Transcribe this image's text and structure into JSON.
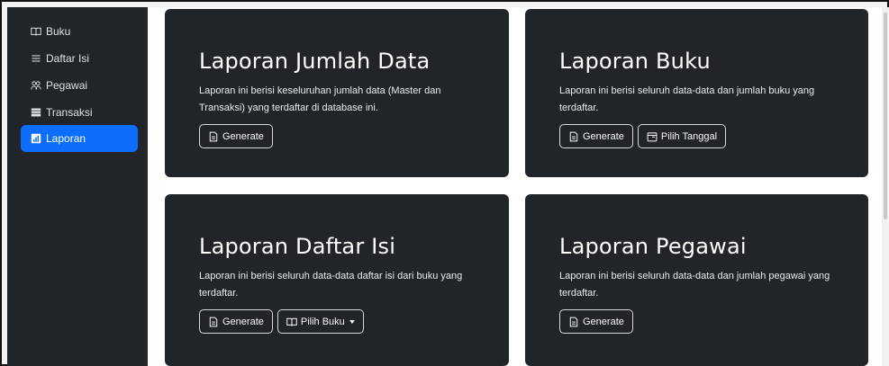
{
  "sidebar": {
    "items": [
      {
        "label": "Buku",
        "icon": "book-icon",
        "active": false
      },
      {
        "label": "Daftar Isi",
        "icon": "list-icon",
        "active": false
      },
      {
        "label": "Pegawai",
        "icon": "people-icon",
        "active": false
      },
      {
        "label": "Transaksi",
        "icon": "wallet-icon",
        "active": false
      },
      {
        "label": "Laporan",
        "icon": "report-icon",
        "active": true
      }
    ]
  },
  "cards": [
    {
      "title": "Laporan Jumlah Data",
      "description": "Laporan ini berisi keseluruhan jumlah data (Master dan Transaksi) yang terdaftar di database ini.",
      "buttons": [
        {
          "label": "Generate",
          "icon": "file-icon"
        }
      ]
    },
    {
      "title": "Laporan Buku",
      "description": "Laporan ini berisi seluruh data-data dan jumlah buku yang terdaftar.",
      "buttons": [
        {
          "label": "Generate",
          "icon": "file-icon"
        },
        {
          "label": "Pilih Tanggal",
          "icon": "calendar-icon"
        }
      ]
    },
    {
      "title": "Laporan Daftar Isi",
      "description": "Laporan ini berisi seluruh data-data daftar isi dari buku yang terdaftar.",
      "buttons": [
        {
          "label": "Generate",
          "icon": "file-icon"
        },
        {
          "label": "Pilih Buku",
          "icon": "book-icon",
          "dropdown": true
        }
      ]
    },
    {
      "title": "Laporan Pegawai",
      "description": "Laporan ini berisi seluruh data-data dan jumlah pegawai yang terdaftar.",
      "buttons": [
        {
          "label": "Generate",
          "icon": "file-icon"
        }
      ]
    }
  ],
  "colors": {
    "sidebar_bg": "#212529",
    "card_bg": "#212529",
    "active": "#0d6efd"
  }
}
